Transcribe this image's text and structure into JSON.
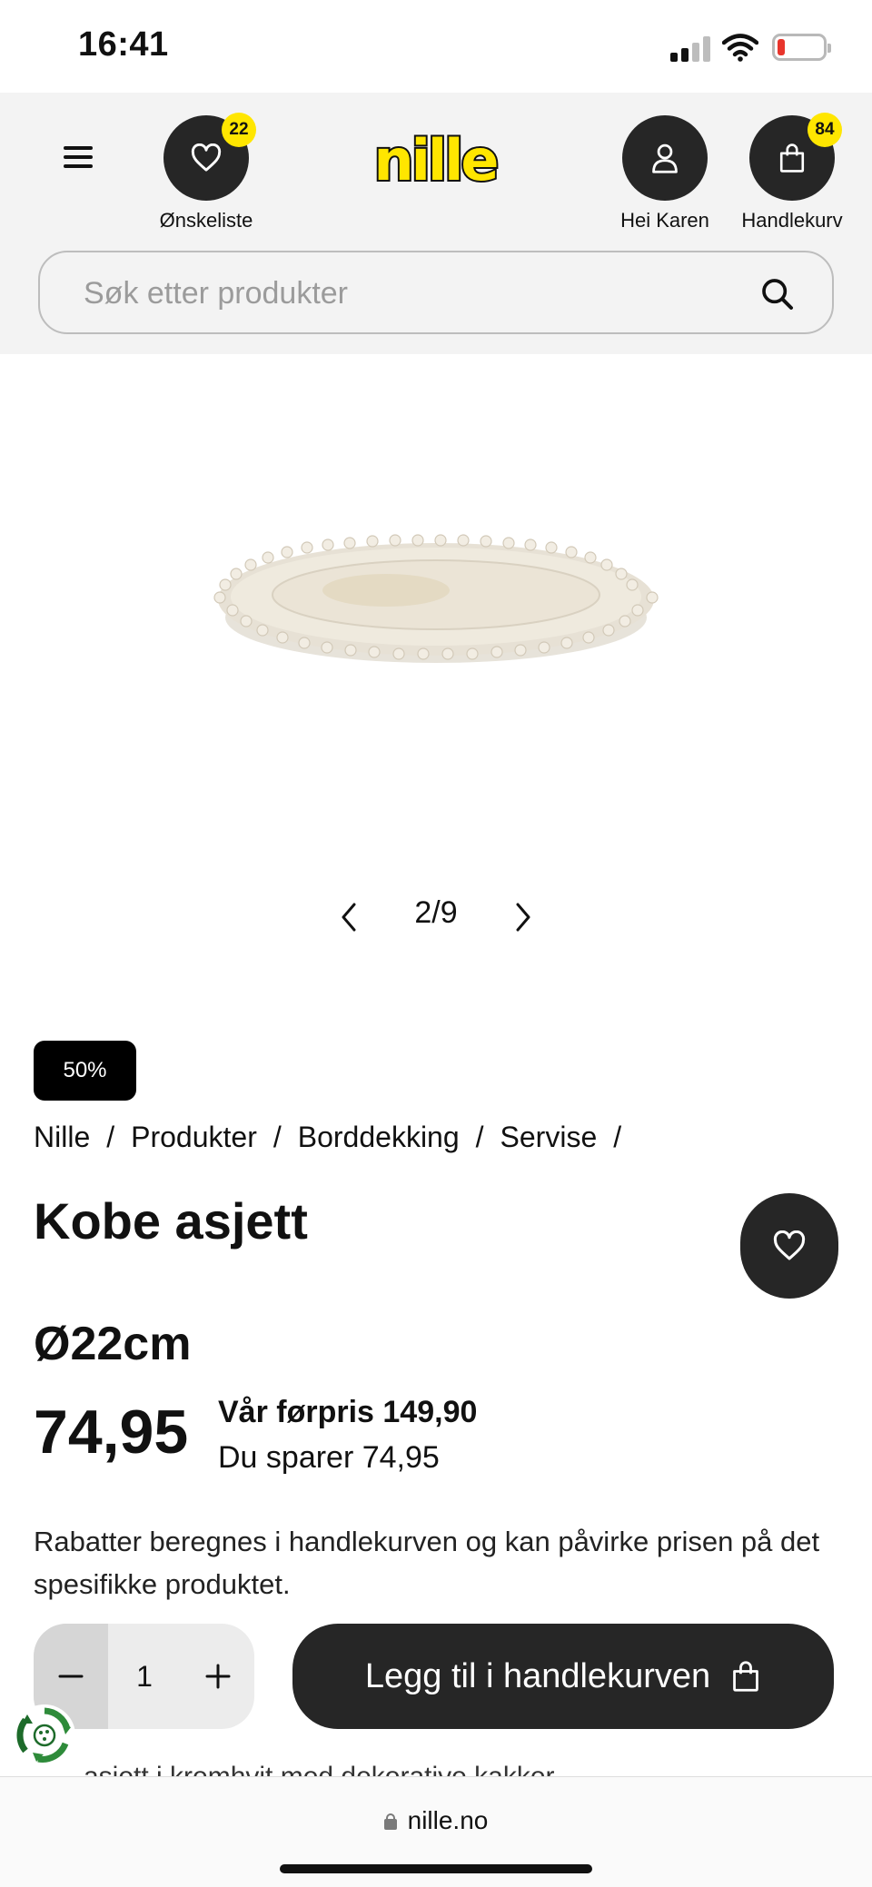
{
  "status_bar": {
    "time": "16:41"
  },
  "header": {
    "wishlist": {
      "label": "Ønskeliste",
      "count": "22"
    },
    "logo_text": "nille",
    "account": {
      "label": "Hei Karen"
    },
    "cart": {
      "label": "Handlekurv",
      "count": "84"
    },
    "search": {
      "placeholder": "Søk etter produkter"
    }
  },
  "gallery": {
    "counter": "2/9"
  },
  "product": {
    "discount_badge": "50%",
    "breadcrumb": [
      "Nille",
      "Produkter",
      "Borddekking",
      "Servise"
    ],
    "breadcrumb_separator": "/",
    "title": "Kobe asjett",
    "size": "Ø22cm",
    "price": "74,95",
    "previous_price": "Vår førpris 149,90",
    "savings": "Du sparer 74,95",
    "disclaimer": "Rabatter beregnes i handlekurven og kan påvirke prisen på det spesifikke produktet.",
    "quantity": "1",
    "add_to_cart_label": "Legg til i handlekurven",
    "description_cutoff": "asjett i kremhvit med dekorative kakker"
  },
  "browser": {
    "url": "nille.no"
  },
  "colors": {
    "accent_yellow": "#ffe600",
    "dark": "#262626"
  }
}
